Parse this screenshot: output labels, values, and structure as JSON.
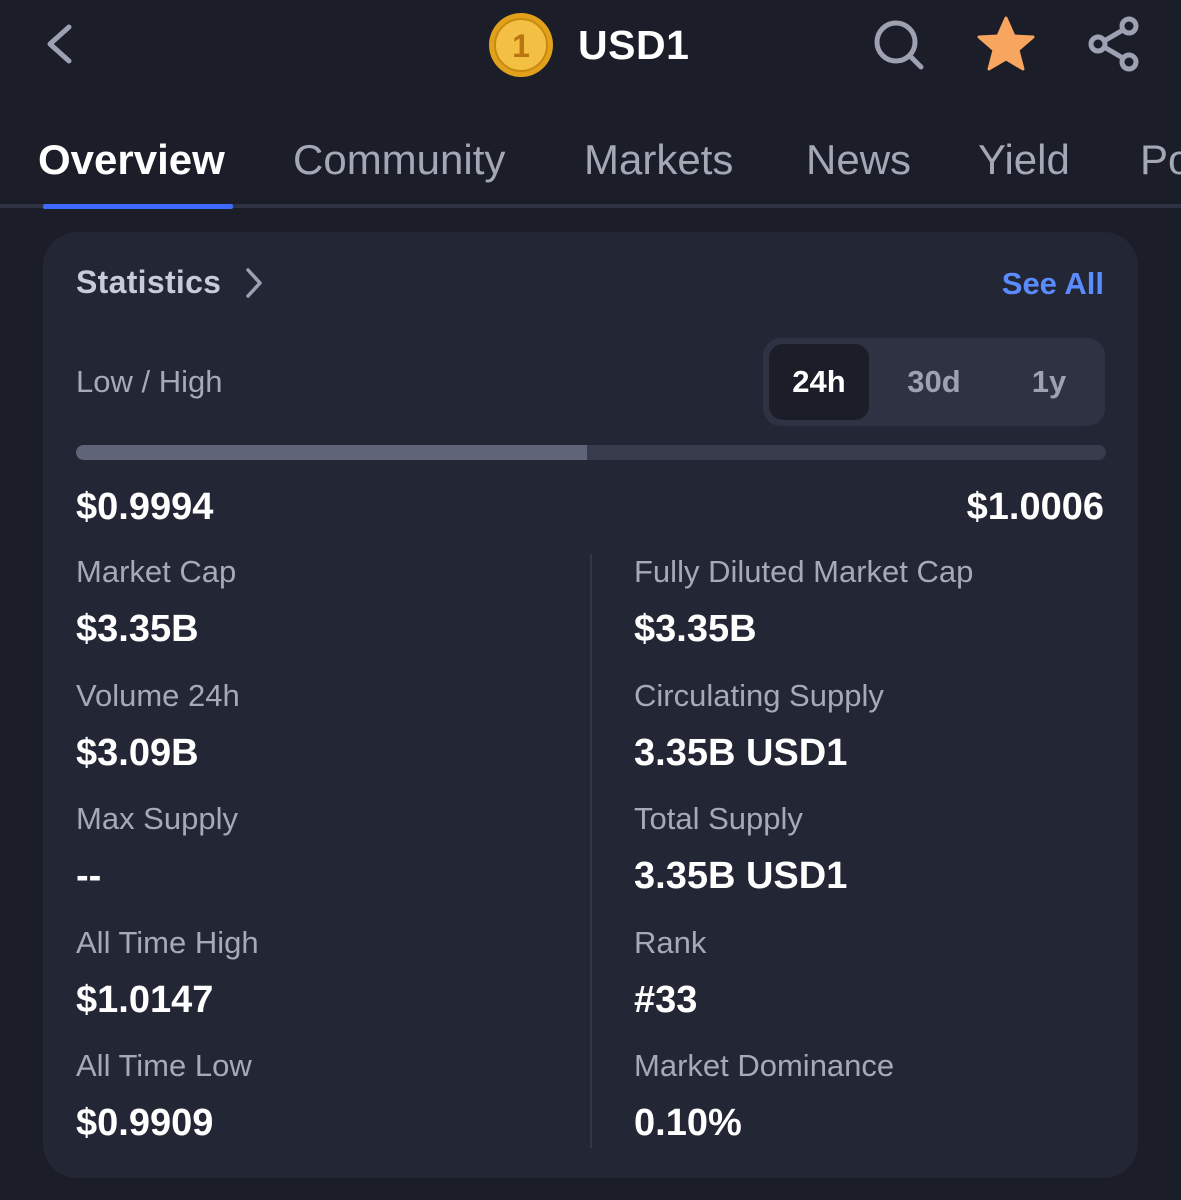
{
  "header": {
    "coin_symbol": "USD1",
    "logo_glyph": "1",
    "icons": [
      "chevron-left-icon",
      "coin-logo-icon",
      "search-icon",
      "star-icon",
      "share-icon"
    ],
    "favorite_color": "#f8a55f"
  },
  "tabs": [
    {
      "label": "Overview",
      "active": true
    },
    {
      "label": "Community"
    },
    {
      "label": "Markets"
    },
    {
      "label": "News"
    },
    {
      "label": "Yield"
    },
    {
      "label": "Po"
    }
  ],
  "statistics": {
    "title": "Statistics",
    "see_all": "See All",
    "range_label": "Low / High",
    "periods": [
      "24h",
      "30d",
      "1y"
    ],
    "selected_period": "24h",
    "low": "$0.9994",
    "high": "$1.0006",
    "range_position_fraction": 0.496,
    "left": [
      {
        "label": "Market Cap",
        "value": "$3.35B"
      },
      {
        "label": "Volume 24h",
        "value": "$3.09B"
      },
      {
        "label": "Max Supply",
        "value": "--"
      },
      {
        "label": "All Time High",
        "value": "$1.0147"
      },
      {
        "label": "All Time Low",
        "value": "$0.9909"
      }
    ],
    "right": [
      {
        "label": "Fully Diluted Market Cap",
        "value": "$3.35B"
      },
      {
        "label": "Circulating Supply",
        "value": "3.35B USD1"
      },
      {
        "label": "Total Supply",
        "value": "3.35B USD1"
      },
      {
        "label": "Rank",
        "value": "#33"
      },
      {
        "label": "Market Dominance",
        "value": "0.10%"
      }
    ]
  },
  "colors": {
    "background": "#1b1d29",
    "card": "#232634",
    "accent": "#3d6bff",
    "link": "#5b8cff"
  }
}
